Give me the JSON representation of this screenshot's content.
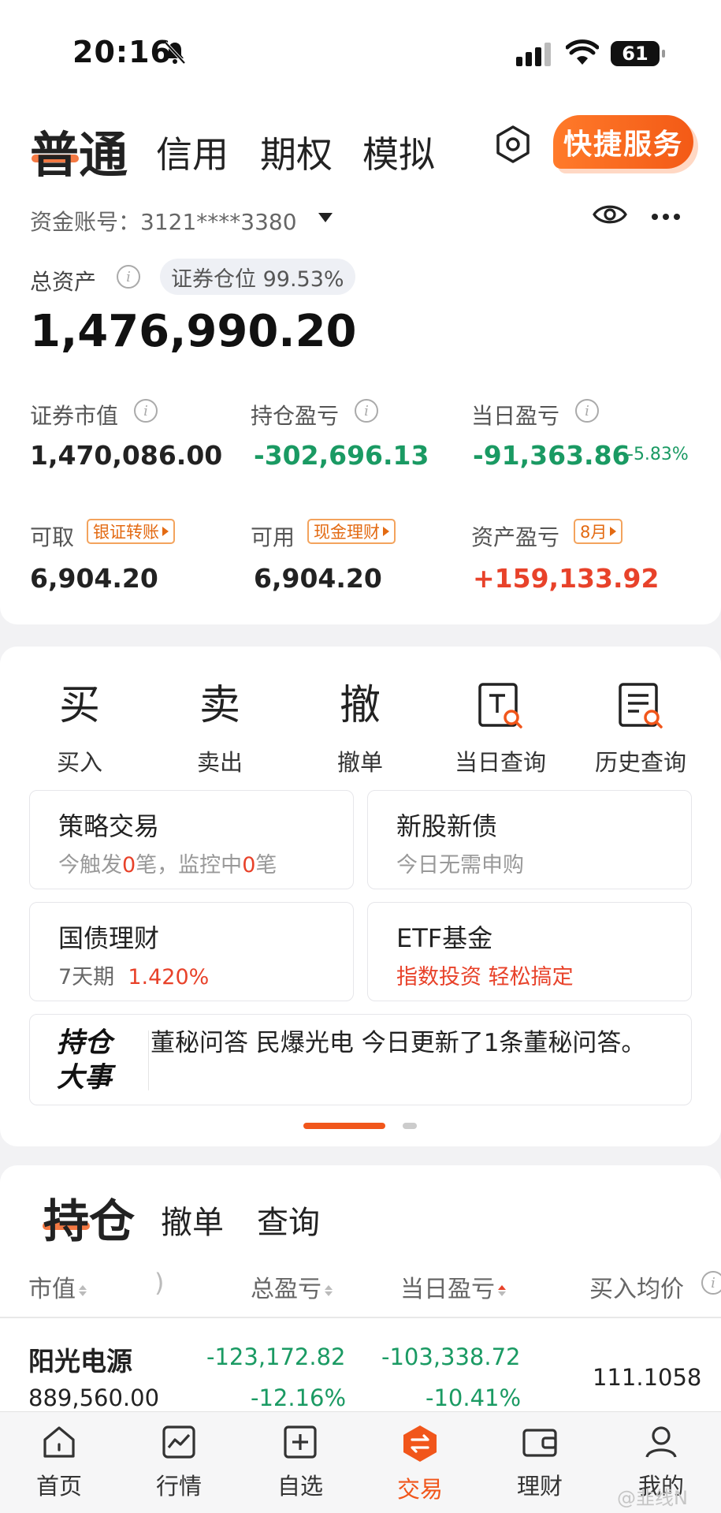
{
  "status": {
    "time": "20:16",
    "battery": "61"
  },
  "header": {
    "tabs": [
      "普通",
      "信用",
      "期权",
      "模拟"
    ],
    "quick_service": "快捷服务"
  },
  "account": {
    "label": "资金账号：3121****3380",
    "total_label": "总资产",
    "position_ratio": "证券仓位 99.53%",
    "total_value": "1,476,990.20",
    "metrics": {
      "market_value_label": "证券市值",
      "market_value": "1,470,086.00",
      "holding_pl_label": "持仓盈亏",
      "holding_pl": "-302,696.13",
      "daily_pl_label": "当日盈亏",
      "daily_pl": "-91,363.86",
      "daily_pl_pct": "-5.83%",
      "withdrawable_label": "可取",
      "withdrawable_tag": "银证转账",
      "withdrawable": "6,904.20",
      "available_label": "可用",
      "available_tag": "现金理财",
      "available": "6,904.20",
      "asset_pl_label": "资产盈亏",
      "asset_pl_tag": "8月",
      "asset_pl": "+159,133.92"
    }
  },
  "actions": [
    {
      "glyph": "买",
      "label": "买入"
    },
    {
      "glyph": "卖",
      "label": "卖出"
    },
    {
      "glyph": "撤",
      "label": "撤单"
    },
    {
      "glyph": "",
      "label": "当日查询"
    },
    {
      "glyph": "",
      "label": "历史查询"
    }
  ],
  "boxes": {
    "strategy_title": "策略交易",
    "strategy_sub_a": "今触发",
    "strategy_count_a": "0",
    "strategy_sub_b": "笔，监控中",
    "strategy_count_b": "0",
    "strategy_sub_c": "笔",
    "ipo_title": "新股新债",
    "ipo_sub": "今日无需申购",
    "bond_title": "国债理财",
    "bond_term": "7天期",
    "bond_rate": "1.420%",
    "etf_title": "ETF基金",
    "etf_sub": "指数投资 轻松搞定"
  },
  "news": {
    "tag_line1": "持仓",
    "tag_line2": "大事",
    "text": "董秘问答 民爆光电 今日更新了1条董秘问答。"
  },
  "holdings": {
    "tabs": [
      "持仓",
      "撤单",
      "查询"
    ],
    "columns": [
      "市值",
      "总盈亏",
      "当日盈亏",
      "买入均价"
    ],
    "rows": [
      {
        "name": "阳光电源",
        "market_value": "889,560.00",
        "total_pl": "-123,172.82",
        "total_pl_pct": "-12.16%",
        "daily_pl": "-103,338.72",
        "daily_pl_pct": "-10.41%",
        "avg_price": "111.1058"
      }
    ]
  },
  "tabbar": [
    "首页",
    "行情",
    "自选",
    "交易",
    "理财",
    "我的"
  ],
  "watermark": "@韭线N",
  "colors": {
    "accent": "#f1561b",
    "up": "#e8422a",
    "down": "#1a9a63"
  }
}
